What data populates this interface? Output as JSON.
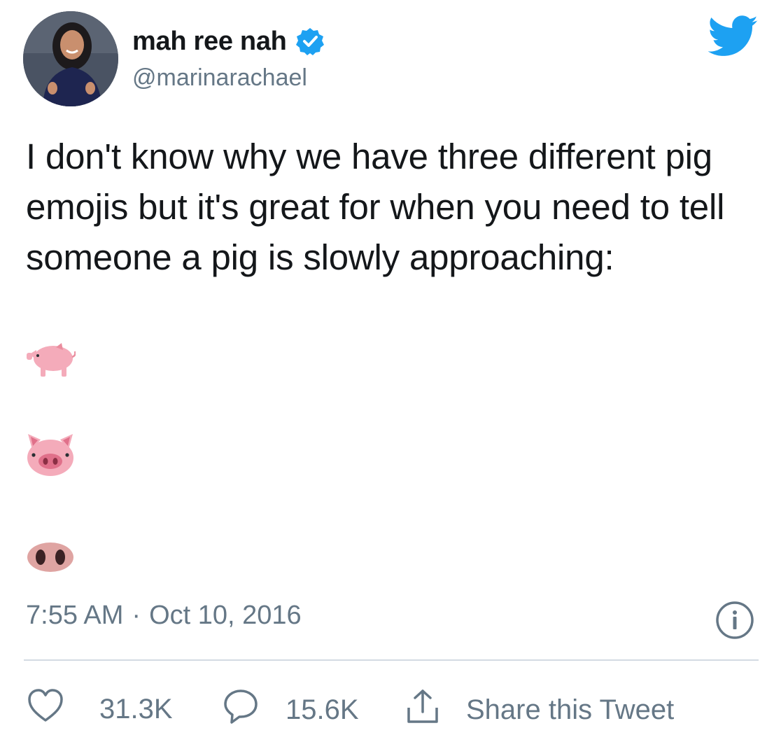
{
  "author": {
    "display_name": "mah ree nah",
    "handle": "@marinarachael",
    "verified": true
  },
  "icons": {
    "verified": "verified-badge-icon",
    "brand": "twitter-bird-icon",
    "info": "info-icon",
    "like": "heart-icon",
    "reply": "reply-bubble-icon",
    "share": "share-upload-icon"
  },
  "tweet": {
    "text": "I don't know why we have three different pig emojis but it's great for when you need to tell someone a pig is slowly approaching:",
    "emojis": [
      "pig",
      "pig-face",
      "pig-nose"
    ]
  },
  "meta": {
    "time": "7:55 AM",
    "separator": "·",
    "date": "Oct 10, 2016"
  },
  "actions": {
    "likes": "31.3K",
    "replies": "15.6K",
    "share_label": "Share this Tweet"
  },
  "colors": {
    "brand_blue": "#1da1f2",
    "muted": "#657786",
    "text": "#14171a",
    "divider": "#d3dbe3"
  }
}
